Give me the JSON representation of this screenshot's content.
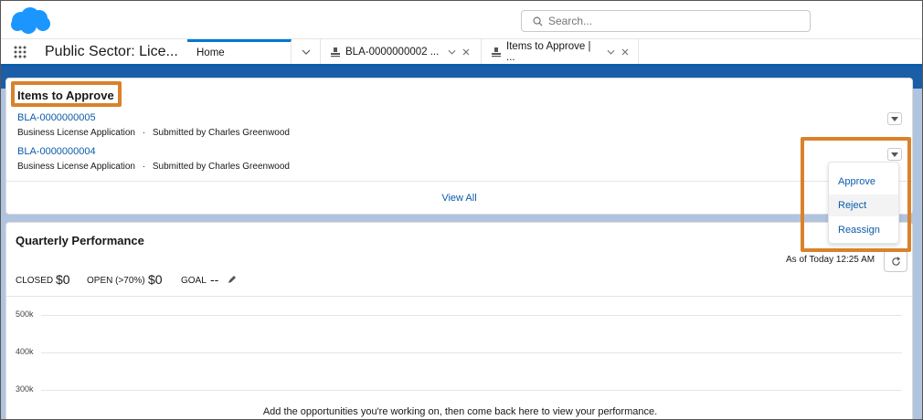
{
  "header": {
    "search_placeholder": "Search..."
  },
  "nav": {
    "app_name": "Public Sector: Lice...",
    "tabs": [
      {
        "label": "Home"
      },
      {
        "label": "BLA-0000000002 ..."
      },
      {
        "label": "Items to Approve | ..."
      }
    ]
  },
  "approvals": {
    "title": "Items to Approve",
    "items": [
      {
        "id": "BLA-0000000005",
        "type": "Business License Application",
        "sep": "·",
        "submitted": "Submitted by Charles Greenwood"
      },
      {
        "id": "BLA-0000000004",
        "type": "Business License Application",
        "sep": "·",
        "submitted": "Submitted by Charles Greenwood"
      }
    ],
    "view_all": "View All",
    "menu": [
      "Approve",
      "Reject",
      "Reassign"
    ]
  },
  "performance": {
    "title": "Quarterly Performance",
    "as_of": "As of Today 12:25 AM",
    "closed_label": "CLOSED",
    "closed_value": "$0",
    "open_label": "OPEN (>70%)",
    "open_value": "$0",
    "goal_label": "GOAL",
    "goal_value": "--",
    "y_ticks": [
      "500k",
      "400k",
      "300k"
    ],
    "empty_message": "Add the opportunities you're working on, then come back here to view your performance."
  },
  "colors": {
    "brand_blue": "#0176d3",
    "link_blue": "#0b5cab",
    "highlight_orange": "#d9822b",
    "cloud_blue": "#1b96ff"
  }
}
